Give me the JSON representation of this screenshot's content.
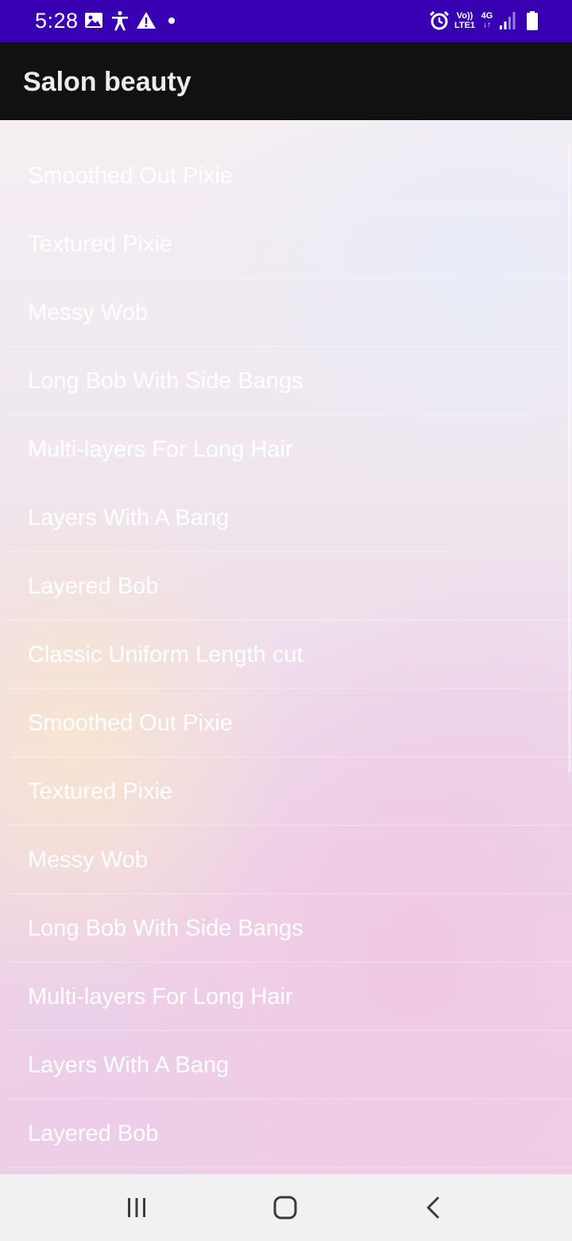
{
  "status_bar": {
    "time": "5:28",
    "icons": [
      "image-icon",
      "accessibility-icon",
      "warning-icon",
      "dot-icon",
      "alarm-icon",
      "signal-icon",
      "battery-icon"
    ],
    "network_label_top": "Vo))",
    "network_label_bottom": "LTE1",
    "network_type": "4G",
    "background_color": "#3700b3"
  },
  "app_bar": {
    "title": "Salon beauty",
    "background_color": "#111111"
  },
  "list": {
    "items": [
      {
        "label": "Smoothed Out Pixie"
      },
      {
        "label": "Textured Pixie"
      },
      {
        "label": "Messy Wob"
      },
      {
        "label": "Long Bob With Side Bangs"
      },
      {
        "label": "Multi-layers For Long Hair"
      },
      {
        "label": "Layers With A Bang"
      },
      {
        "label": "Layered Bob"
      },
      {
        "label": "Classic Uniform Length cut"
      },
      {
        "label": "Smoothed Out Pixie"
      },
      {
        "label": "Textured Pixie"
      },
      {
        "label": "Messy Wob"
      },
      {
        "label": "Long Bob With Side Bangs"
      },
      {
        "label": "Multi-layers For Long Hair"
      },
      {
        "label": "Layers With A Bang"
      },
      {
        "label": "Layered Bob"
      }
    ]
  },
  "nav_bar": {
    "buttons": [
      "recents-icon",
      "home-icon",
      "back-icon"
    ]
  }
}
